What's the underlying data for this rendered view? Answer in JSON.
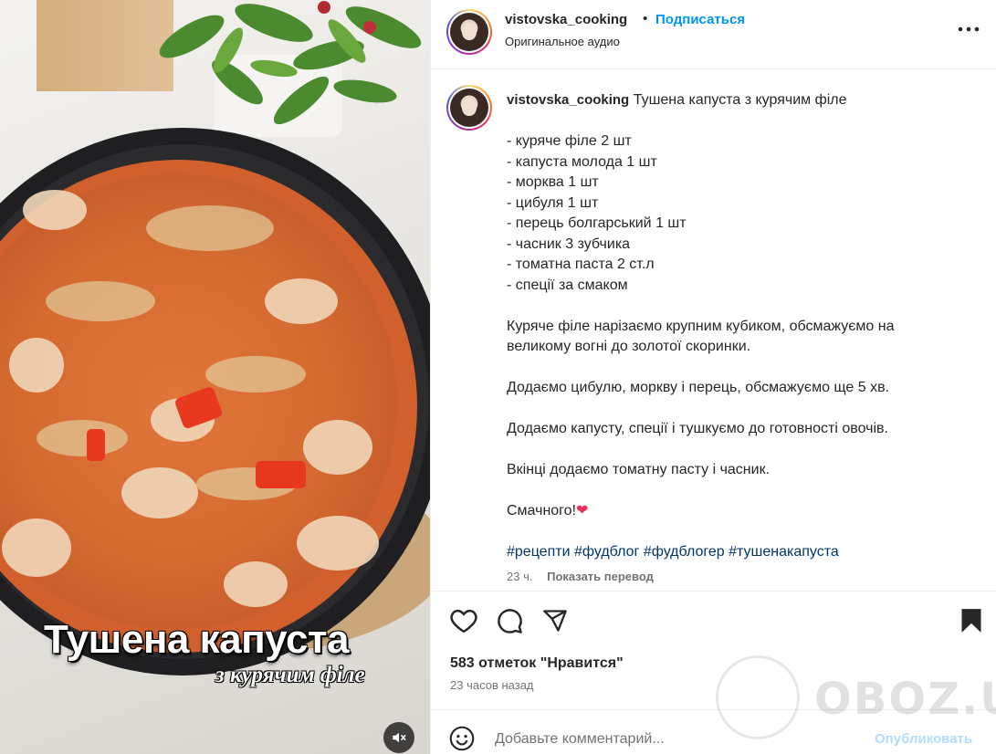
{
  "media": {
    "overlay_title": "Тушена капуста",
    "overlay_subtitle": "з курячим філе",
    "mute_icon": "speaker-muted-icon"
  },
  "header": {
    "username": "vistovska_cooking",
    "separator": "•",
    "follow_label": "Подписаться",
    "audio_label": "Оригинальное аудио",
    "more_icon": "more-horizontal-icon"
  },
  "caption": {
    "username": "vistovska_cooking",
    "title": "Тушена капуста з курячим філе",
    "ingredients": [
      "- куряче філе 2 шт",
      "- капуста молода 1 шт",
      "- морква 1 шт",
      "- цибуля 1 шт",
      "- перець болгарський 1 шт",
      "- часник 3 зубчика",
      "- томатна паста 2 ст.л",
      "- спеції за смаком"
    ],
    "steps": [
      "Куряче філе нарізаємо крупним кубиком, обсмажуємо на великому вогні до золотої скоринки.",
      "Додаємо цибулю, моркву і перець, обсмажуємо ще 5 хв.",
      "Додаємо капусту, спеції і тушкуємо до готовності овочів.",
      "Вкінці додаємо томатну пасту і часник."
    ],
    "closing": "Смачного!",
    "closing_emoji": "❤",
    "hashtags": [
      "#рецепти",
      "#фудблог",
      "#фудблогер",
      "#тушенакапуста"
    ],
    "time": "23 ч.",
    "translate_label": "Показать перевод"
  },
  "actions": {
    "like_icon": "heart-icon",
    "comment_icon": "comment-icon",
    "share_icon": "share-icon",
    "save_icon": "bookmark-icon",
    "likes_text": "583 отметок \"Нравится\"",
    "time_ago": "23 часов назад"
  },
  "comment": {
    "emoji_icon": "emoji-icon",
    "placeholder": "Добавьте комментарий...",
    "publish_label": "Опубликовать"
  },
  "watermark": {
    "text": "OBOZ.UA"
  },
  "colors": {
    "accent": "#0095f6",
    "publish_disabled": "#b3dbff",
    "hashtag": "#00376b",
    "muted_text": "#737373"
  }
}
